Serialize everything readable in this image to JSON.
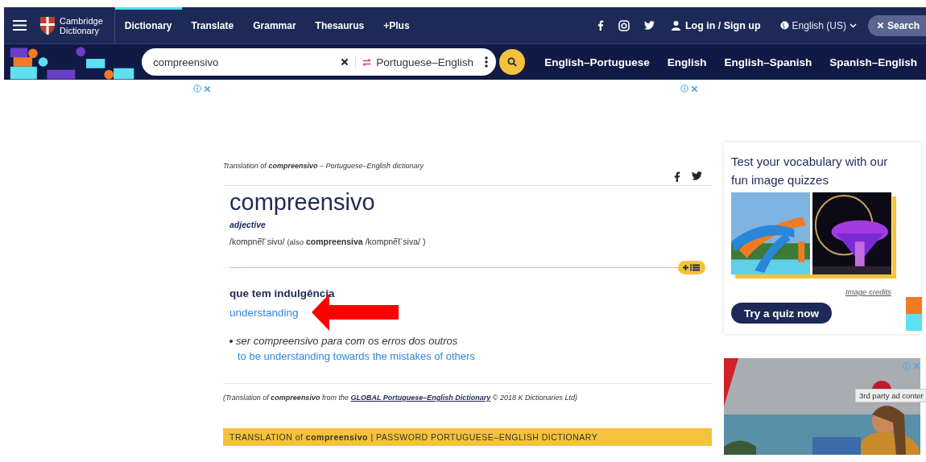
{
  "header": {
    "logo": [
      "Cambridge",
      "Dictionary"
    ],
    "nav": [
      {
        "label": "Dictionary",
        "selected": true
      },
      {
        "label": "Translate",
        "selected": false
      },
      {
        "label": "Grammar",
        "selected": false
      },
      {
        "label": "Thesaurus",
        "selected": false
      },
      {
        "label": "+Plus",
        "selected": false
      }
    ],
    "login": "Log in / Sign up",
    "language": "English (US)",
    "search_toggle": "Search"
  },
  "searchbar": {
    "value": "compreensivo",
    "dictionary": "Portuguese–English",
    "links": [
      "English–Portuguese",
      "English",
      "English–Spanish",
      "Spanish–English"
    ]
  },
  "entry": {
    "source": "Translation of **compreensivo** – Portuguese–English dictionary",
    "headword": "compreensivo",
    "pos": "adjective",
    "pron": "/kompnẽĩˈsivʊ/",
    "also_prefix": "(also",
    "also_word": "compreensiva",
    "also_pron": "/kompnẽĩˈsiva/",
    "also_close": ")",
    "sense": "que tem indulgência",
    "translation": "understanding",
    "example": "ser compreensivo para com os erros dos outros",
    "example_translation": "to be understanding towards the mistakes of others",
    "credit_pre": "(Translation of **compreensivo** from the",
    "credit_link": "GLOBAL Portuguese–English Dictionary",
    "credit_post": "© 2018 K Dictionaries Ltd)",
    "banner": "TRANSLATION of **compreensivo** | PASSWORD PORTUGUESE–ENGLISH DICTIONARY"
  },
  "quiz": {
    "title": "Test your vocabulary with our fun image quizzes",
    "credits": "Image credits",
    "button": "Try a quiz now"
  },
  "ad": {
    "tooltip": "3rd party ad conter"
  }
}
